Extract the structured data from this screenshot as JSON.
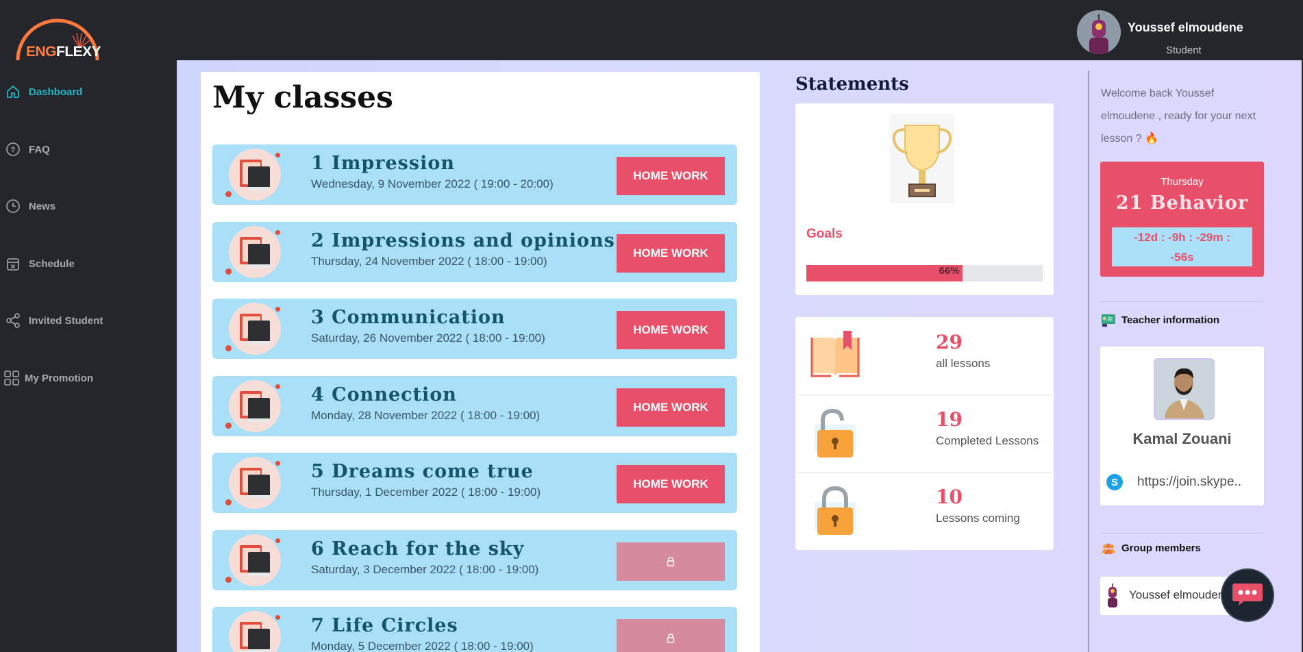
{
  "app": {
    "logo_eng": "ENG",
    "logo_flexy": "FLEXY"
  },
  "user": {
    "name": "Youssef elmoudene",
    "role": "Student"
  },
  "sidebar": {
    "items": [
      {
        "label": "Dashboard",
        "icon": "home-icon",
        "active": true
      },
      {
        "label": "FAQ",
        "icon": "question-icon",
        "active": false
      },
      {
        "label": "News",
        "icon": "clock-icon",
        "active": false
      },
      {
        "label": "Schedule",
        "icon": "calendar-icon",
        "active": false
      },
      {
        "label": "Invited Student",
        "icon": "share-icon",
        "active": false
      },
      {
        "label": "My Promotion",
        "icon": "grid-icon",
        "active": false
      }
    ]
  },
  "classes": {
    "title": "My classes",
    "button_label": "HOME WORK",
    "locked_icon": "lock-icon",
    "items": [
      {
        "title": "1 Impression",
        "date": "Wednesday, 9 November 2022 ( 19:00 - 20:00)",
        "locked": false
      },
      {
        "title": "2 Impressions and opinions",
        "date": "Thursday, 24 November 2022 ( 18:00 - 19:00)",
        "locked": false
      },
      {
        "title": "3 Communication",
        "date": "Saturday, 26 November 2022 ( 18:00 - 19:00)",
        "locked": false
      },
      {
        "title": "4 Connection",
        "date": "Monday, 28 November 2022 ( 18:00 - 19:00)",
        "locked": false
      },
      {
        "title": "5 Dreams come true",
        "date": "Thursday, 1 December 2022 ( 18:00 - 19:00)",
        "locked": false
      },
      {
        "title": "6 Reach for the sky",
        "date": "Saturday, 3 December 2022 ( 18:00 - 19:00)",
        "locked": true
      },
      {
        "title": "7 Life Circles",
        "date": "Monday, 5 December 2022 ( 18:00 - 19:00)",
        "locked": true
      }
    ]
  },
  "statements": {
    "title": "Statements",
    "goals_label": "Goals",
    "goals_progress": 0.66,
    "goals_progress_text": "66%",
    "stats": [
      {
        "value": "29",
        "label": "all lessons",
        "icon": "book-icon"
      },
      {
        "value": "19",
        "label": "Completed Lessons",
        "icon": "unlocked-padlock-icon"
      },
      {
        "value": "10",
        "label": "Lessons coming",
        "icon": "locked-padlock-icon"
      }
    ]
  },
  "next_lesson": {
    "welcome": "Welcome back Youssef elmoudene , ready for your next lesson ? 🔥",
    "day": "Thursday",
    "title": "21 Behavior",
    "countdown_line1": "-12d : -9h : -29m :",
    "countdown_line2": "-56s"
  },
  "teacher": {
    "section_title": "Teacher information",
    "name": "Kamal Zouani",
    "skype": "https://join.skype.."
  },
  "group": {
    "section_title": "Group members",
    "members": [
      "Youssef elmoudene"
    ]
  },
  "colors": {
    "accent": "#e8506a",
    "card": "#a9dff7",
    "sidebar": "#24262b",
    "active_nav": "#1fb8c4"
  }
}
